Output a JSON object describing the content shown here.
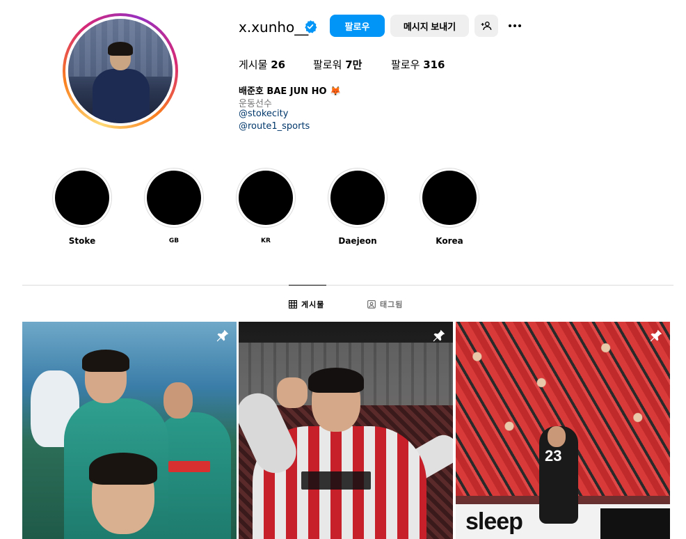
{
  "profile": {
    "username": "x.xunho__",
    "verified_icon": "verified-badge-icon",
    "follow_label": "팔로우",
    "message_label": "메시지 보내기",
    "add_user_icon": "add-user-icon",
    "more_icon": "more-options-icon"
  },
  "stats": {
    "posts_label": "게시물",
    "posts_value": "26",
    "followers_label": "팔로워",
    "followers_value": "7만",
    "following_label": "팔로우",
    "following_value": "316"
  },
  "bio": {
    "name": "배준호 BAE JUN HO 🦊",
    "category": "운동선수",
    "link1": "@stokecity",
    "link2": "@route1_sports"
  },
  "highlights": [
    {
      "label": "Stoke"
    },
    {
      "label": "GB"
    },
    {
      "label": "KR"
    },
    {
      "label": "Daejeon"
    },
    {
      "label": "Korea"
    }
  ],
  "tabs": {
    "posts_label": "게시물",
    "posts_icon": "grid-icon",
    "tagged_label": "태그됨",
    "tagged_icon": "tagged-icon"
  },
  "posts": [
    {
      "pinned": true,
      "pin_icon": "pin-icon"
    },
    {
      "pinned": true,
      "pin_icon": "pin-icon"
    },
    {
      "pinned": true,
      "pin_icon": "pin-icon",
      "board_text": "sleep",
      "jersey_number": "23"
    }
  ],
  "colors": {
    "accent": "#0095f6",
    "link": "#00376b",
    "secondary_text": "#737373",
    "button_gray": "#efefef",
    "divider": "#dbdbdb"
  }
}
